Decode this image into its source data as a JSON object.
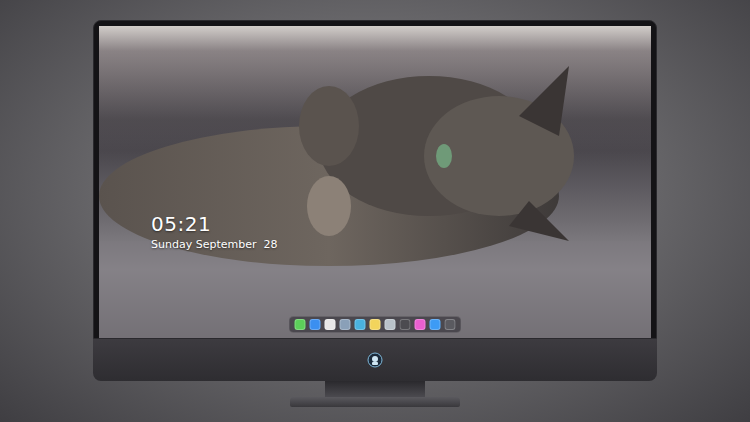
{
  "lock_screen": {
    "time": "05:21",
    "date": "Sunday September  28"
  },
  "dock": {
    "items": [
      {
        "color": "#5ccf5a"
      },
      {
        "color": "#3b8ff0"
      },
      {
        "color": "#e8e8e8"
      },
      {
        "color": "#8aa0b8"
      },
      {
        "color": "#4ab3e0"
      },
      {
        "color": "#f2d45c"
      },
      {
        "color": "#b9c2c9"
      },
      {
        "color": "#4c4b50"
      },
      {
        "color": "#e95fd0"
      },
      {
        "color": "#3d9bf5"
      },
      {
        "color": "#5a5a60"
      }
    ]
  }
}
